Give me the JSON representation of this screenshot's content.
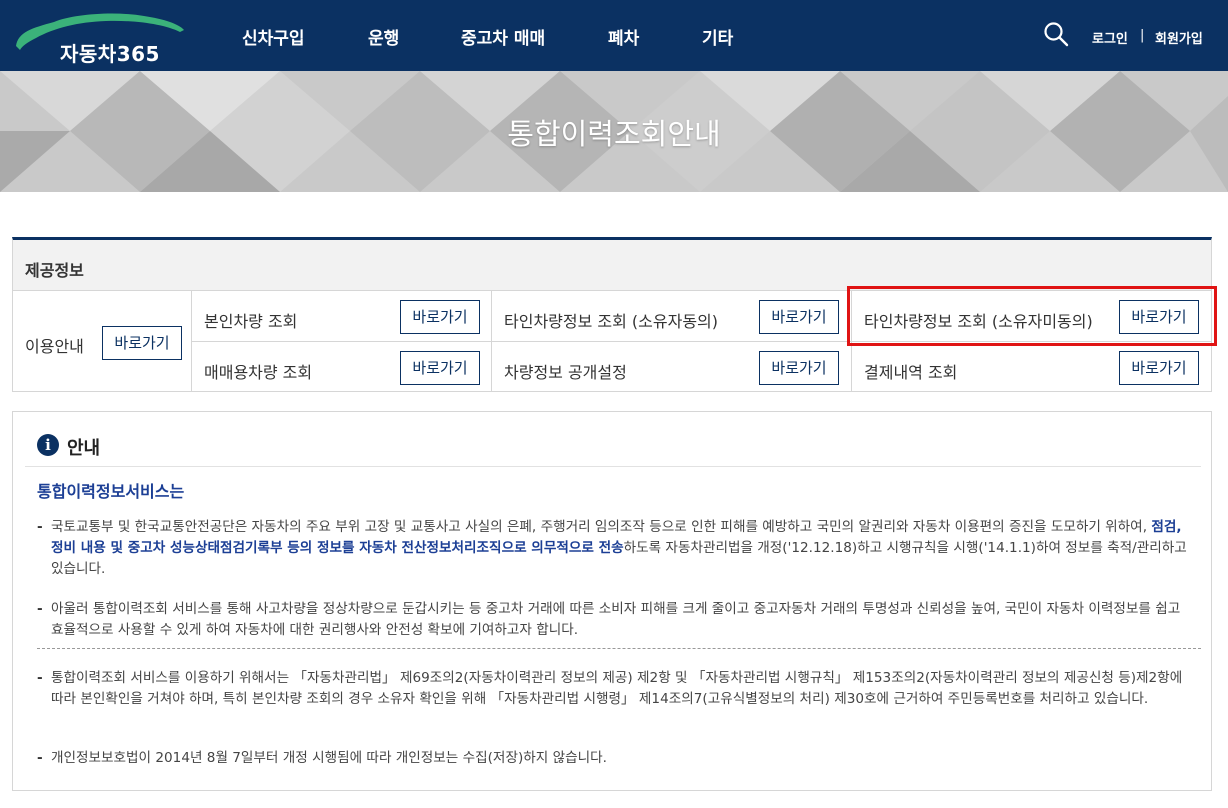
{
  "header": {
    "logo_text": "자동차365",
    "nav": [
      "신차구입",
      "운행",
      "중고차 매매",
      "폐차",
      "기타"
    ],
    "login": "로그인",
    "divider": "|",
    "signup": "회원가입"
  },
  "banner": {
    "title": "통합이력조회안내"
  },
  "info": {
    "heading": "제공정보",
    "usage_label": "이용안내",
    "button_label": "바로가기",
    "items": [
      "본인차량 조회",
      "타인차량정보 조회 (소유자동의)",
      "타인차량정보 조회 (소유자미동의)",
      "매매용차량 조회",
      "차량정보 공개설정",
      "결제내역 조회"
    ]
  },
  "notice": {
    "title": "안내",
    "subtitle": "통합이력정보서비스는",
    "p1_a": "국토교통부 및 한국교통안전공단은 자동차의 주요 부위 고장 및 교통사고 사실의 은폐, 주행거리 임의조작 등으로 인한 피해를 예방하고 국민의 알권리와 자동차 이용편의 증진을 도모하기 위하여, ",
    "p1_b": "점검,정비 내용 및 중고차 성능상태점검기록부 등의 정보를 자동차 전산정보처리조직으로 의무적으로 전송",
    "p1_c": "하도록 자동차관리법을 개정('12.12.18)하고 시행규칙을 시행('14.1.1)하여 정보를 축적/관리하고 있습니다.",
    "p2": "아울러 통합이력조회 서비스를 통해 사고차량을 정상차량으로 둔갑시키는 등 중고차 거래에 따른 소비자 피해를 크게 줄이고 중고자동차 거래의 투명성과 신뢰성을 높여, 국민이 자동차 이력정보를 쉽고 효율적으로 사용할 수 있게 하여 자동차에 대한 권리행사와 안전성 확보에 기여하고자 합니다.",
    "p3": "통합이력조회 서비스를 이용하기 위해서는 「자동차관리법」 제69조의2(자동차이력관리 정보의 제공) 제2항 및 「자동차관리법 시행규칙」 제153조의2(자동차이력관리 정보의 제공신청 등)제2항에 따라 본인확인을 거쳐야 하며, 특히 본인차량 조회의 경우 소유자 확인을 위해 「자동차관리법 시행령」 제14조의7(고유식별정보의 처리) 제30호에 근거하여 주민등록번호를 처리하고 있습니다.",
    "p4": "개인정보보호법이 2014년 8월 7일부터 개정 시행됨에 따라 개인정보는 수집(저장)하지 않습니다.",
    "dash": "-"
  },
  "colors": {
    "brand_navy": "#0b3162",
    "highlight_red": "#e01414",
    "accent_blue": "#1c3f95"
  },
  "icons": [
    "car-logo",
    "search-icon",
    "info-icon"
  ]
}
